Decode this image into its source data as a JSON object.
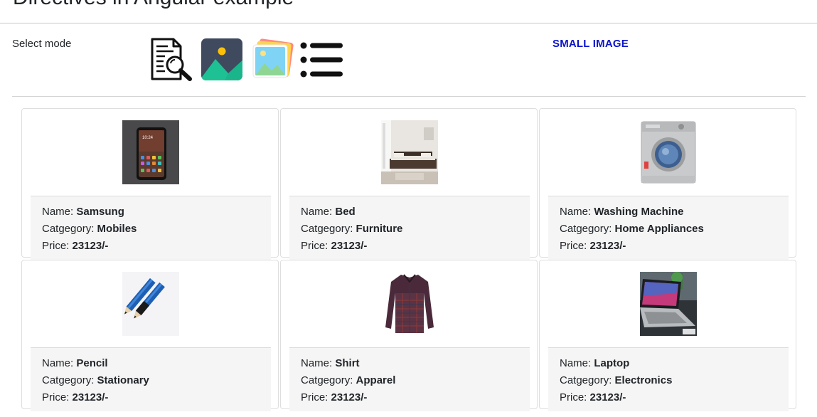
{
  "header": {
    "title": "Directives in Angular example"
  },
  "mode_selector": {
    "label": "Select mode",
    "icons": [
      "document-search-icon",
      "image-icon",
      "images-icon",
      "list-icon"
    ],
    "current_mode": "SMALL IMAGE"
  },
  "labels": {
    "name": "Name: ",
    "category": "Catgegory: ",
    "price": "Price: "
  },
  "products": [
    {
      "name": "Samsung",
      "category": "Mobiles",
      "price": "23123/-",
      "image_icon": "phone-image"
    },
    {
      "name": "Bed",
      "category": "Furniture",
      "price": "23123/-",
      "image_icon": "bed-image"
    },
    {
      "name": "Washing Machine",
      "category": "Home Appliances",
      "price": "23123/-",
      "image_icon": "washing-machine-image"
    },
    {
      "name": "Pencil",
      "category": "Stationary",
      "price": "23123/-",
      "image_icon": "pencil-image"
    },
    {
      "name": "Shirt",
      "category": "Apparel",
      "price": "23123/-",
      "image_icon": "shirt-image"
    },
    {
      "name": "Laptop",
      "category": "Electronics",
      "price": "23123/-",
      "image_icon": "laptop-image"
    }
  ]
}
